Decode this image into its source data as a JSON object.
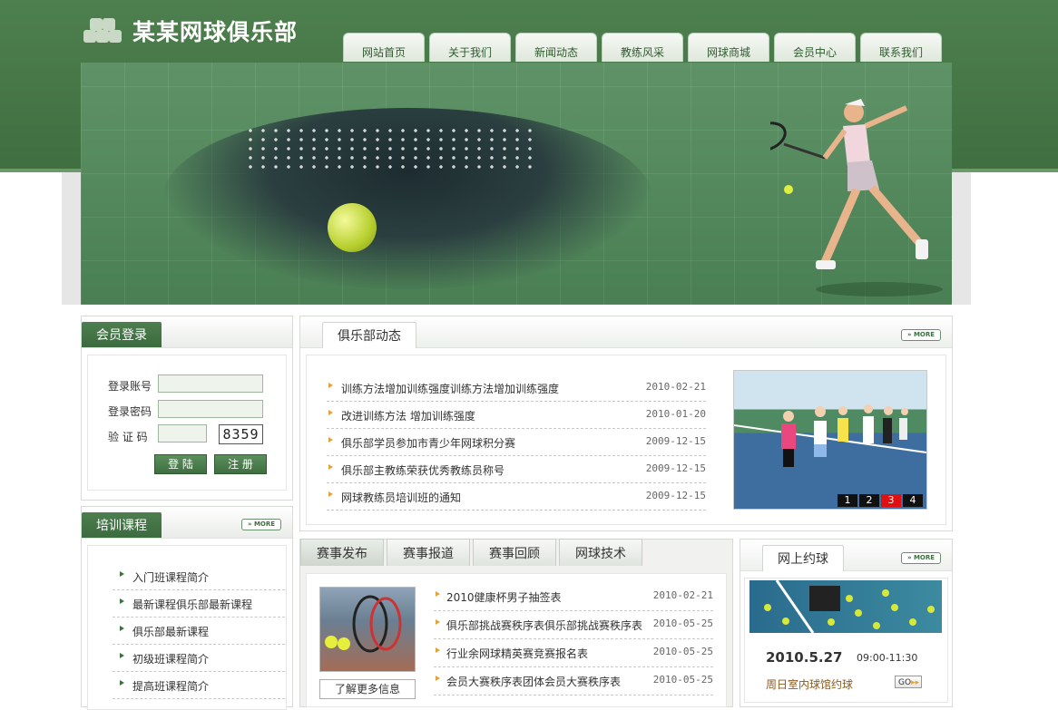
{
  "site": {
    "title": "某某网球俱乐部"
  },
  "nav": [
    "网站首页",
    "关于我们",
    "新闻动态",
    "教练风采",
    "网球商城",
    "会员中心",
    "联系我们"
  ],
  "login": {
    "title": "会员登录",
    "account_label": "登录账号",
    "password_label": "登录密码",
    "captcha_label": "验 证 码",
    "captcha_value": "8359",
    "login_button": "登 陆",
    "register_button": "注 册"
  },
  "courses": {
    "title": "培训课程",
    "more": "MORE",
    "items": [
      "入门班课程简介",
      "最新课程俱乐部最新课程",
      "俱乐部最新课程",
      "初级班课程简介",
      "提高班课程简介"
    ]
  },
  "club_news": {
    "title": "俱乐部动态",
    "more": "MORE",
    "items": [
      {
        "title": "训练方法增加训练强度训练方法增加训练强度",
        "date": "2010-02-21"
      },
      {
        "title": "改进训练方法 增加训练强度",
        "date": "2010-01-20"
      },
      {
        "title": "俱乐部学员参加市青少年网球积分赛",
        "date": "2009-12-15"
      },
      {
        "title": "俱乐部主教练荣获优秀教练员称号",
        "date": "2009-12-15"
      },
      {
        "title": "网球教练员培训班的通知",
        "date": "2009-12-15"
      }
    ],
    "pager": [
      "1",
      "2",
      "3",
      "4"
    ],
    "pager_active": "3"
  },
  "events": {
    "tabs": [
      "赛事发布",
      "赛事报道",
      "赛事回顾",
      "网球技术"
    ],
    "more_info": "了解更多信息",
    "items": [
      {
        "title": "2010健康杯男子抽签表",
        "date": "2010-02-21"
      },
      {
        "title": "俱乐部挑战赛秩序表俱乐部挑战赛秩序表",
        "date": "2010-05-25"
      },
      {
        "title": "行业余网球精英赛竞赛报名表",
        "date": "2010-05-25"
      },
      {
        "title": "会员大赛秩序表团体会员大赛秩序表",
        "date": "2010-05-25"
      }
    ]
  },
  "booking": {
    "title": "网上约球",
    "more": "MORE",
    "date": "2010.5.27",
    "time": "09:00-11:30",
    "venue": "周日室内球馆约球",
    "go": "GO"
  }
}
